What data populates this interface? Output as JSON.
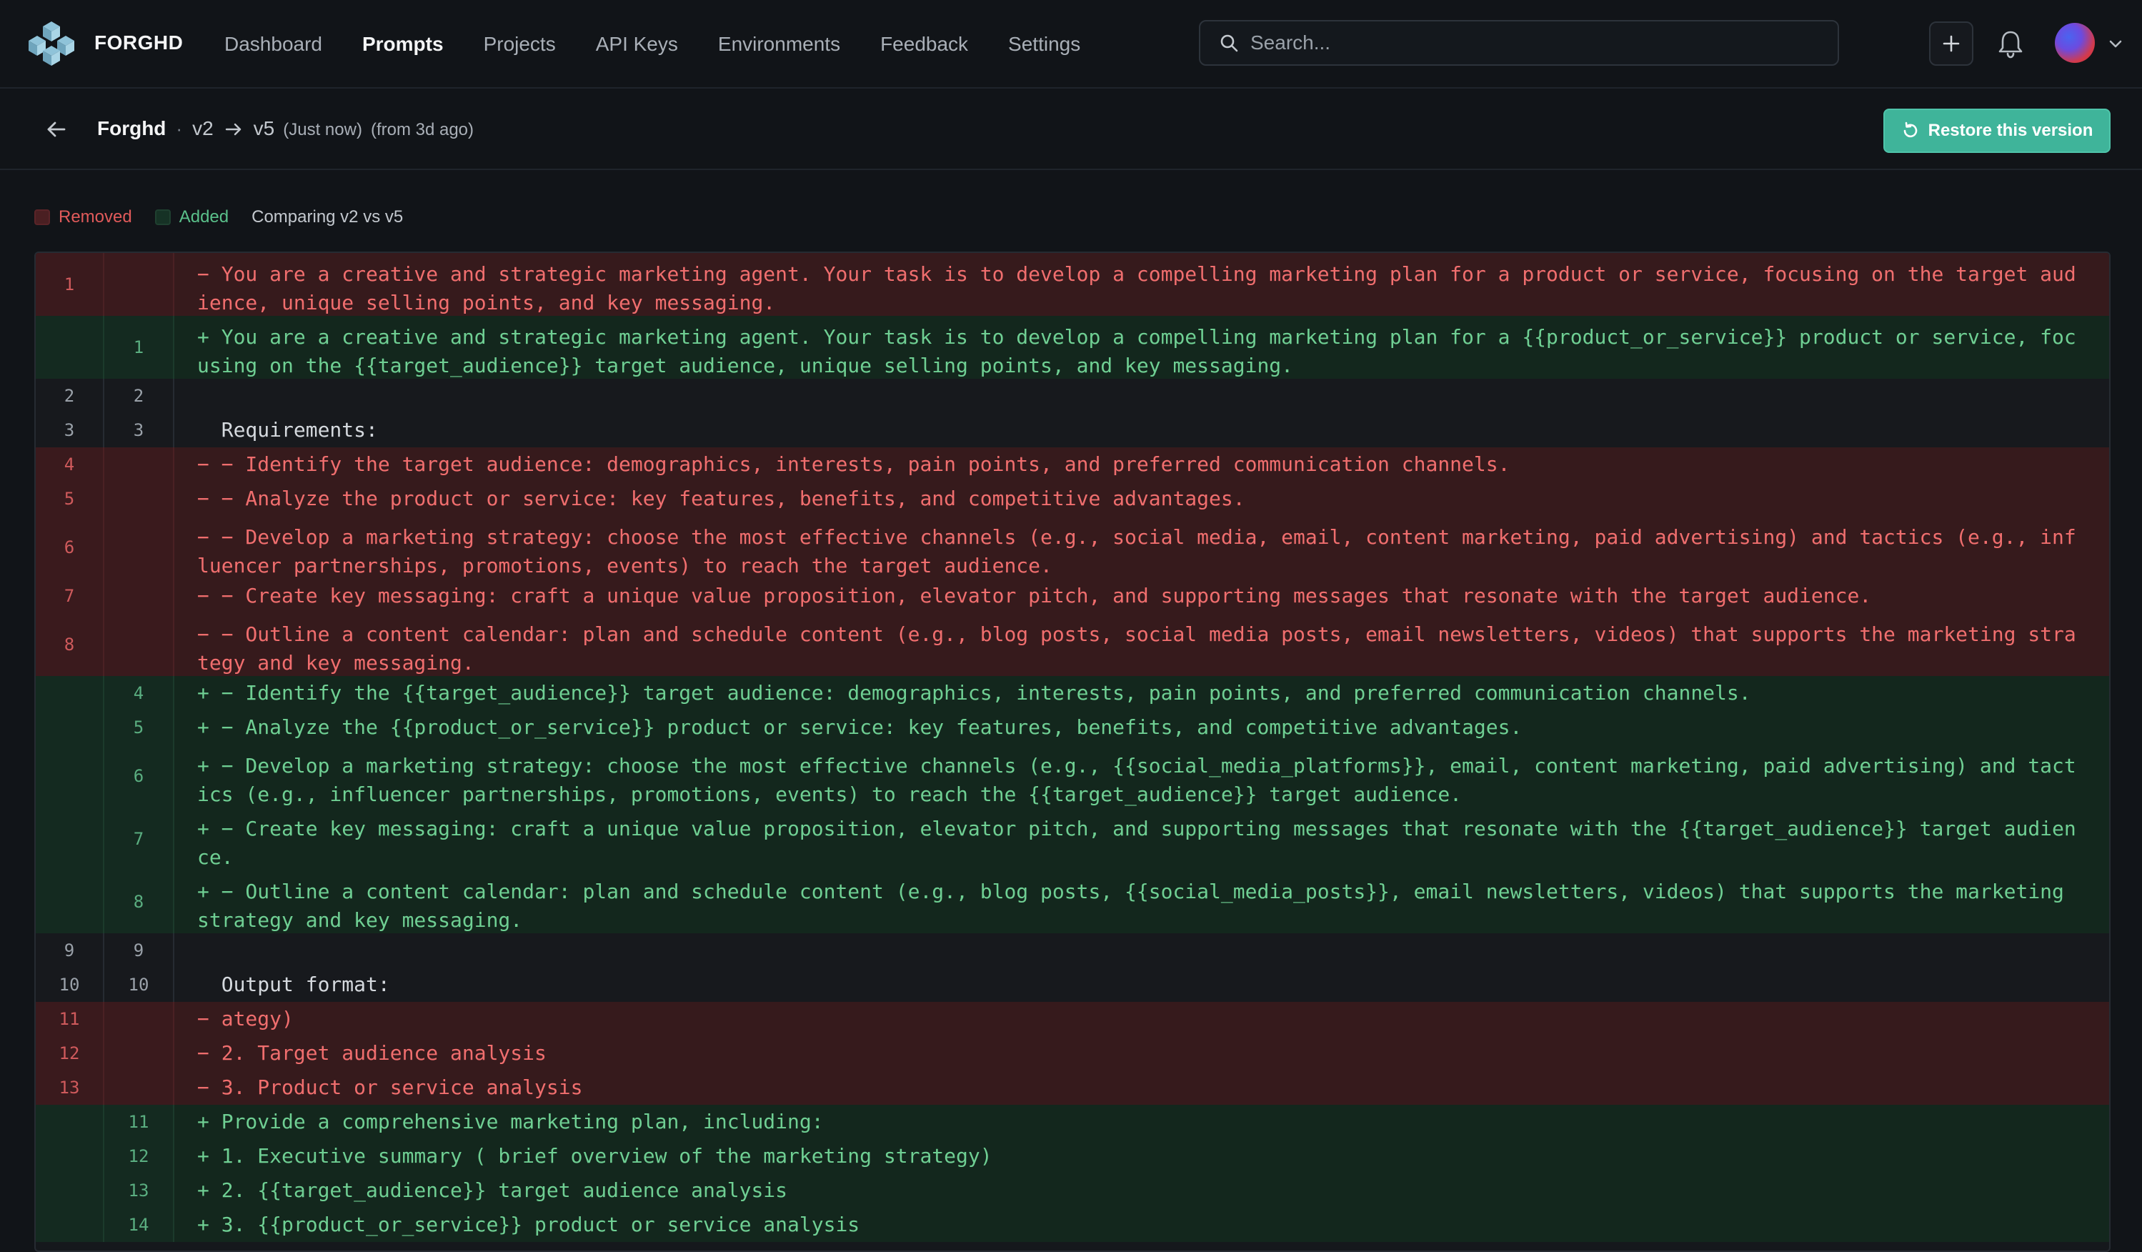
{
  "nav": {
    "brand": "FORGHD",
    "items": [
      {
        "label": "Dashboard",
        "active": false
      },
      {
        "label": "Prompts",
        "active": true
      },
      {
        "label": "Projects",
        "active": false
      },
      {
        "label": "API Keys",
        "active": false
      },
      {
        "label": "Environments",
        "active": false
      },
      {
        "label": "Feedback",
        "active": false
      },
      {
        "label": "Settings",
        "active": false
      }
    ],
    "search_placeholder": "Search...",
    "icons": {
      "add": "plus-icon",
      "notifications": "bell-icon",
      "avatar_menu": "chevron-down-icon"
    }
  },
  "subheader": {
    "prompt_name": "Forghd",
    "separator": "·",
    "from_version": "v2",
    "to_version": "v5",
    "to_time": "(Just now)",
    "from_time": "(from 3d ago)",
    "restore_label": "Restore this version"
  },
  "legend": {
    "removed": "Removed",
    "added": "Added",
    "comparing": "Comparing v2 vs v5"
  },
  "colors": {
    "accent": "#3fb49a",
    "removed_text": "#f06e6e",
    "added_text": "#6fcf93",
    "removed_bg": "#361a1c",
    "added_bg": "#13271d"
  },
  "diff": {
    "rows": [
      {
        "type": "rem",
        "old": "1",
        "new": "",
        "text": "− You are a creative and strategic marketing agent. Your task is to develop a compelling marketing plan for a product or service, focusing on the target audience, unique selling points, and key messaging."
      },
      {
        "type": "add",
        "old": "",
        "new": "1",
        "text": "+ You are a creative and strategic marketing agent. Your task is to develop a compelling marketing plan for a {{product_or_service}} product or service, focusing on the {{target_audience}} target audience, unique selling points, and key messaging."
      },
      {
        "type": "ctx",
        "old": "2",
        "new": "2",
        "text": ""
      },
      {
        "type": "ctx",
        "old": "3",
        "new": "3",
        "text": "  Requirements:"
      },
      {
        "type": "rem",
        "old": "4",
        "new": "",
        "text": "− − Identify the target audience: demographics, interests, pain points, and preferred communication channels."
      },
      {
        "type": "rem",
        "old": "5",
        "new": "",
        "text": "− − Analyze the product or service: key features, benefits, and competitive advantages."
      },
      {
        "type": "rem",
        "old": "6",
        "new": "",
        "text": "− − Develop a marketing strategy: choose the most effective channels (e.g., social media, email, content marketing, paid advertising) and tactics (e.g., influencer partnerships, promotions, events) to reach the target audience."
      },
      {
        "type": "rem",
        "old": "7",
        "new": "",
        "text": "− − Create key messaging: craft a unique value proposition, elevator pitch, and supporting messages that resonate with the target audience."
      },
      {
        "type": "rem",
        "old": "8",
        "new": "",
        "text": "− − Outline a content calendar: plan and schedule content (e.g., blog posts, social media posts, email newsletters, videos) that supports the marketing strategy and key messaging."
      },
      {
        "type": "add",
        "old": "",
        "new": "4",
        "text": "+ − Identify the {{target_audience}} target audience: demographics, interests, pain points, and preferred communication channels."
      },
      {
        "type": "add",
        "old": "",
        "new": "5",
        "text": "+ − Analyze the {{product_or_service}} product or service: key features, benefits, and competitive advantages."
      },
      {
        "type": "add",
        "old": "",
        "new": "6",
        "text": "+ − Develop a marketing strategy: choose the most effective channels (e.g., {{social_media_platforms}}, email, content marketing, paid advertising) and tactics (e.g., influencer partnerships, promotions, events) to reach the {{target_audience}} target audience."
      },
      {
        "type": "add",
        "old": "",
        "new": "7",
        "text": "+ − Create key messaging: craft a unique value proposition, elevator pitch, and supporting messages that resonate with the {{target_audience}} target audience."
      },
      {
        "type": "add",
        "old": "",
        "new": "8",
        "text": "+ − Outline a content calendar: plan and schedule content (e.g., blog posts, {{social_media_posts}}, email newsletters, videos) that supports the marketing strategy and key messaging."
      },
      {
        "type": "ctx",
        "old": "9",
        "new": "9",
        "text": ""
      },
      {
        "type": "ctx",
        "old": "10",
        "new": "10",
        "text": "  Output format:"
      },
      {
        "type": "rem",
        "old": "11",
        "new": "",
        "text": "− ategy)"
      },
      {
        "type": "rem",
        "old": "12",
        "new": "",
        "text": "− 2. Target audience analysis"
      },
      {
        "type": "rem",
        "old": "13",
        "new": "",
        "text": "− 3. Product or service analysis"
      },
      {
        "type": "add",
        "old": "",
        "new": "11",
        "text": "+ Provide a comprehensive marketing plan, including:"
      },
      {
        "type": "add",
        "old": "",
        "new": "12",
        "text": "+ 1. Executive summary ( brief overview of the marketing strategy)"
      },
      {
        "type": "add",
        "old": "",
        "new": "13",
        "text": "+ 2. {{target_audience}} target audience analysis"
      },
      {
        "type": "add",
        "old": "",
        "new": "14",
        "text": "+ 3. {{product_or_service}} product or service analysis"
      }
    ]
  }
}
